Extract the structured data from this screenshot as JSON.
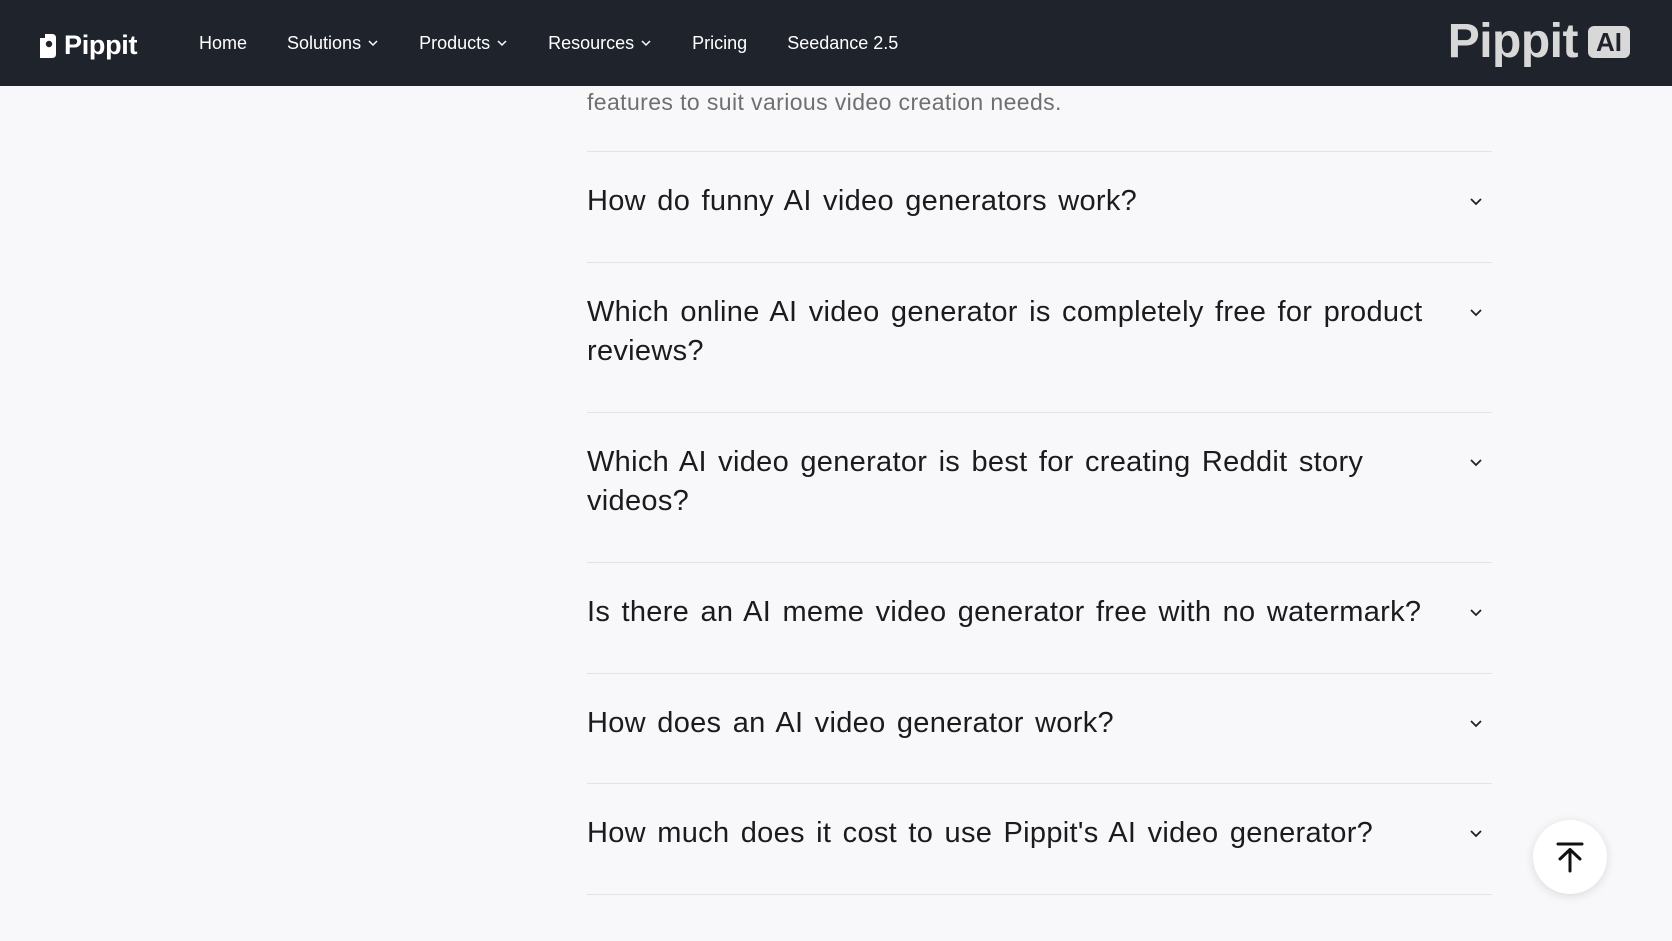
{
  "nav": {
    "logo_text": "Pippit",
    "items": [
      {
        "label": "Home",
        "dropdown": false
      },
      {
        "label": "Solutions",
        "dropdown": true
      },
      {
        "label": "Products",
        "dropdown": true
      },
      {
        "label": "Resources",
        "dropdown": true
      },
      {
        "label": "Pricing",
        "dropdown": false
      },
      {
        "label": "Seedance 2.5",
        "dropdown": false
      }
    ],
    "brand_text": "Pippit",
    "brand_badge": "AI"
  },
  "faq": {
    "previous_answer_tail": "features to suit various video creation needs.",
    "questions": [
      "How do funny AI video generators work?",
      "Which online AI video generator is completely free for product reviews?",
      "Which AI video generator is best for creating Reddit story videos?",
      "Is there an AI meme video generator free with no watermark?",
      "How does an AI video generator work?",
      "How much does it cost to use Pippit's AI video generator?"
    ]
  },
  "icons": {
    "chevron": "chevron-down-icon",
    "back_to_top": "arrow-up-to-line-icon"
  },
  "colors": {
    "nav_bg": "#1f232b",
    "page_bg": "#f8f8fa",
    "divider": "#e3e3e6"
  }
}
